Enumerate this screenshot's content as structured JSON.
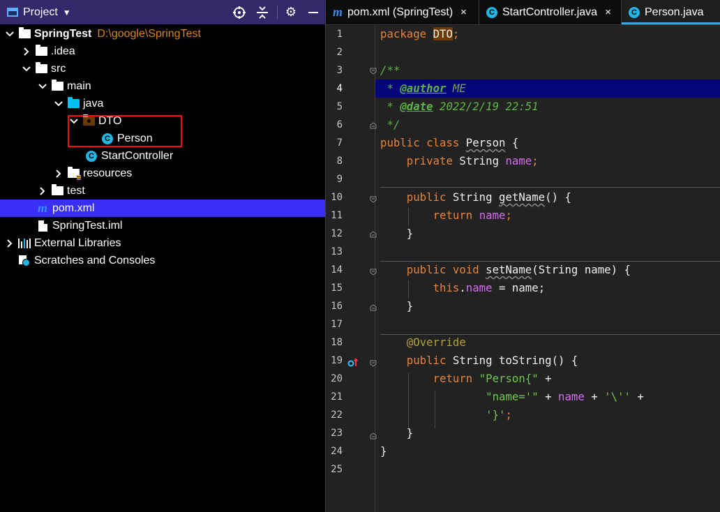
{
  "project_pane": {
    "title": "Project",
    "tree": [
      {
        "label": "SpringTest",
        "path": "D:\\google\\SpringTest",
        "icon": "module-folder-icon",
        "expanded": true
      },
      {
        "label": ".idea",
        "icon": "folder-icon",
        "expanded": false
      },
      {
        "label": "src",
        "icon": "folder-icon",
        "expanded": true
      },
      {
        "label": "main",
        "icon": "folder-icon",
        "expanded": true
      },
      {
        "label": "java",
        "icon": "source-folder-icon",
        "expanded": true
      },
      {
        "label": "DTO",
        "icon": "package-icon",
        "expanded": true
      },
      {
        "label": "Person",
        "icon": "class-icon"
      },
      {
        "label": "StartController",
        "icon": "class-icon"
      },
      {
        "label": "resources",
        "icon": "resources-folder-icon",
        "expanded": false
      },
      {
        "label": "test",
        "icon": "folder-icon",
        "expanded": false
      },
      {
        "label": "pom.xml",
        "icon": "maven-icon",
        "selected": true
      },
      {
        "label": "SpringTest.iml",
        "icon": "iml-file-icon"
      },
      {
        "label": "External Libraries",
        "icon": "libraries-icon",
        "expanded": false
      },
      {
        "label": "Scratches and Consoles",
        "icon": "scratches-icon"
      }
    ]
  },
  "editor": {
    "tabs": [
      {
        "label": "pom.xml (SpringTest)",
        "icon": "maven-icon",
        "close": "×"
      },
      {
        "label": "StartController.java",
        "icon": "class-icon",
        "close": "×"
      },
      {
        "label": "Person.java",
        "icon": "class-icon",
        "active": true
      }
    ],
    "current_line": 4,
    "line_numbers": [
      "1",
      "2",
      "3",
      "4",
      "5",
      "6",
      "7",
      "8",
      "9",
      "10",
      "11",
      "12",
      "13",
      "14",
      "15",
      "16",
      "17",
      "18",
      "19",
      "20",
      "21",
      "22",
      "23",
      "24",
      "25"
    ],
    "code": {
      "l1_kw": "package",
      "l1_pkg": "DTO",
      "l1_end": ";",
      "l3": "/**",
      "l4_star": " * ",
      "l4_tag": "@author",
      "l4_val": " ME",
      "l5_star": " * ",
      "l5_tag": "@date",
      "l5_val": " 2022/2/19 22:51",
      "l6": " */",
      "l7_kw": "public class",
      "l7_name": "Person",
      "l7_end": " {",
      "l8_kw": "private",
      "l8_type": " String ",
      "l8_field": "name",
      "l8_end": ";",
      "l10_kw": "public",
      "l10_type": " String ",
      "l10_name": "getName",
      "l10_end": "() {",
      "l11_kw": "return",
      "l11_field": "name",
      "l11_end": ";",
      "l12": "}",
      "l14_kw": "public void",
      "l14_name": "setName",
      "l14_end": "(String name) {",
      "l15_kw": "this",
      "l15_dot": ".",
      "l15_field": "name",
      "l15_end": " = name;",
      "l16": "}",
      "l18": "@Override",
      "l19_kw": "public",
      "l19_type": " String ",
      "l19_end": "toString() {",
      "l20_kw": "return",
      "l20_str": "\"Person{\"",
      "l20_end": " +",
      "l21_str": "\"name='\"",
      "l21_mid": " + ",
      "l21_field": "name",
      "l21_mid2": " + ",
      "l21_str2": "'\\''",
      "l21_end": " +",
      "l22_str": "'}'",
      "l22_end": ";",
      "l23": "}",
      "l24": "}"
    }
  }
}
